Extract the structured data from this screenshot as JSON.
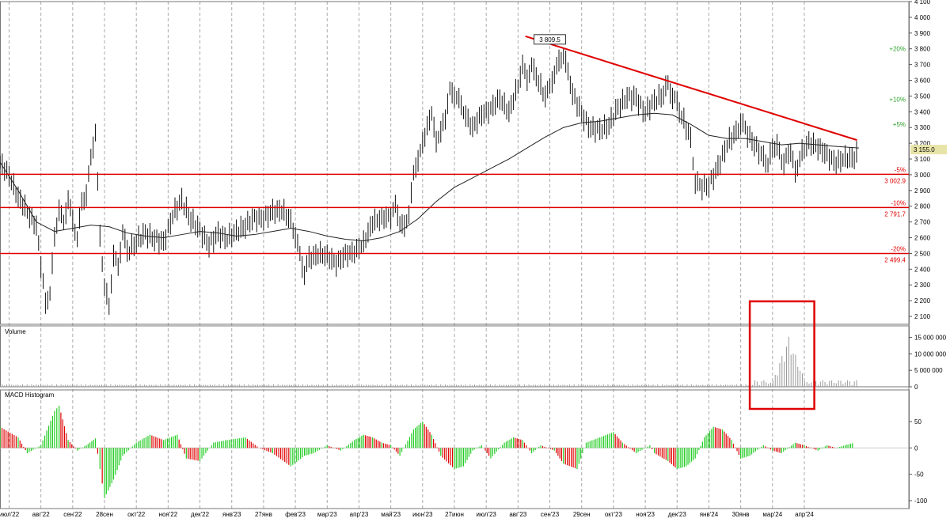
{
  "chart_data": {
    "type": "line",
    "price_panel": {
      "ylim": [
        2050,
        4100
      ],
      "y_ticks": [
        "2 100",
        "2 200",
        "2 300",
        "2 400",
        "2 500",
        "2 600",
        "2 700",
        "2 800",
        "2 900",
        "3 000",
        "3 100",
        "3 200",
        "3 300",
        "3 400",
        "3 500",
        "3 600",
        "3 700",
        "3 800",
        "3 900",
        "4 000",
        "4 100"
      ],
      "last_price_label": "3 155.0",
      "last_price": 3155.0,
      "peak_label": "3 809.5",
      "peak_value": 3809.5,
      "support_levels": [
        {
          "value": 3002.9,
          "label": "3 002.9",
          "pct_label": "-5%"
        },
        {
          "value": 2791.7,
          "label": "2 791.7",
          "pct_label": "-10%"
        },
        {
          "value": 2499.4,
          "label": "2 499.4",
          "pct_label": "-20%"
        }
      ],
      "upper_levels": [
        {
          "value": 3800,
          "pct_label": "+20%"
        },
        {
          "value": 3480,
          "pct_label": "+10%"
        },
        {
          "value": 3320,
          "pct_label": "+5%"
        }
      ],
      "trendline": {
        "start": {
          "x": 0.578,
          "y": 3880
        },
        "end": {
          "x": 0.943,
          "y": 3220
        }
      },
      "price_path": [
        [
          0.0,
          3080
        ],
        [
          0.01,
          2990
        ],
        [
          0.02,
          2860
        ],
        [
          0.03,
          2760
        ],
        [
          0.04,
          2680
        ],
        [
          0.05,
          2180
        ],
        [
          0.055,
          2250
        ],
        [
          0.06,
          2600
        ],
        [
          0.065,
          2780
        ],
        [
          0.07,
          2690
        ],
        [
          0.075,
          2850
        ],
        [
          0.08,
          2700
        ],
        [
          0.085,
          2600
        ],
        [
          0.09,
          2820
        ],
        [
          0.095,
          2880
        ],
        [
          0.1,
          3100
        ],
        [
          0.105,
          3280
        ],
        [
          0.11,
          2600
        ],
        [
          0.115,
          2300
        ],
        [
          0.12,
          2150
        ],
        [
          0.125,
          2500
        ],
        [
          0.13,
          2400
        ],
        [
          0.135,
          2650
        ],
        [
          0.14,
          2500
        ],
        [
          0.15,
          2580
        ],
        [
          0.16,
          2620
        ],
        [
          0.17,
          2600
        ],
        [
          0.18,
          2560
        ],
        [
          0.19,
          2750
        ],
        [
          0.2,
          2830
        ],
        [
          0.21,
          2720
        ],
        [
          0.22,
          2640
        ],
        [
          0.23,
          2560
        ],
        [
          0.24,
          2620
        ],
        [
          0.25,
          2600
        ],
        [
          0.26,
          2630
        ],
        [
          0.27,
          2680
        ],
        [
          0.28,
          2720
        ],
        [
          0.29,
          2730
        ],
        [
          0.3,
          2760
        ],
        [
          0.31,
          2780
        ],
        [
          0.32,
          2700
        ],
        [
          0.325,
          2620
        ],
        [
          0.33,
          2480
        ],
        [
          0.335,
          2380
        ],
        [
          0.34,
          2460
        ],
        [
          0.35,
          2500
        ],
        [
          0.36,
          2480
        ],
        [
          0.37,
          2440
        ],
        [
          0.38,
          2490
        ],
        [
          0.39,
          2510
        ],
        [
          0.4,
          2560
        ],
        [
          0.41,
          2700
        ],
        [
          0.42,
          2720
        ],
        [
          0.43,
          2740
        ],
        [
          0.435,
          2800
        ],
        [
          0.44,
          2700
        ],
        [
          0.445,
          2660
        ],
        [
          0.45,
          2760
        ],
        [
          0.455,
          3000
        ],
        [
          0.46,
          3100
        ],
        [
          0.47,
          3300
        ],
        [
          0.475,
          3400
        ],
        [
          0.48,
          3200
        ],
        [
          0.49,
          3360
        ],
        [
          0.495,
          3540
        ],
        [
          0.5,
          3500
        ],
        [
          0.505,
          3480
        ],
        [
          0.51,
          3400
        ],
        [
          0.52,
          3300
        ],
        [
          0.53,
          3380
        ],
        [
          0.54,
          3420
        ],
        [
          0.55,
          3480
        ],
        [
          0.56,
          3400
        ],
        [
          0.57,
          3560
        ],
        [
          0.575,
          3700
        ],
        [
          0.58,
          3600
        ],
        [
          0.585,
          3700
        ],
        [
          0.59,
          3620
        ],
        [
          0.6,
          3500
        ],
        [
          0.605,
          3560
        ],
        [
          0.61,
          3640
        ],
        [
          0.615,
          3720
        ],
        [
          0.62,
          3760
        ],
        [
          0.625,
          3650
        ],
        [
          0.63,
          3520
        ],
        [
          0.64,
          3380
        ],
        [
          0.65,
          3300
        ],
        [
          0.66,
          3280
        ],
        [
          0.67,
          3320
        ],
        [
          0.68,
          3420
        ],
        [
          0.69,
          3500
        ],
        [
          0.7,
          3480
        ],
        [
          0.71,
          3400
        ],
        [
          0.72,
          3460
        ],
        [
          0.73,
          3520
        ],
        [
          0.735,
          3570
        ],
        [
          0.74,
          3500
        ],
        [
          0.745,
          3450
        ],
        [
          0.75,
          3380
        ],
        [
          0.76,
          3220
        ],
        [
          0.765,
          2960
        ],
        [
          0.77,
          2920
        ],
        [
          0.78,
          2940
        ],
        [
          0.79,
          3040
        ],
        [
          0.8,
          3200
        ],
        [
          0.81,
          3260
        ],
        [
          0.815,
          3340
        ],
        [
          0.82,
          3280
        ],
        [
          0.83,
          3200
        ],
        [
          0.84,
          3100
        ],
        [
          0.845,
          3080
        ],
        [
          0.85,
          3150
        ],
        [
          0.855,
          3210
        ],
        [
          0.86,
          3060
        ],
        [
          0.87,
          3160
        ],
        [
          0.875,
          3000
        ],
        [
          0.88,
          3120
        ],
        [
          0.89,
          3200
        ],
        [
          0.9,
          3180
        ],
        [
          0.91,
          3120
        ],
        [
          0.92,
          3080
        ],
        [
          0.93,
          3100
        ],
        [
          0.94,
          3110
        ],
        [
          0.945,
          3155
        ]
      ],
      "ma_path": [
        [
          0.0,
          3080
        ],
        [
          0.02,
          2900
        ],
        [
          0.04,
          2700
        ],
        [
          0.06,
          2640
        ],
        [
          0.08,
          2660
        ],
        [
          0.1,
          2680
        ],
        [
          0.12,
          2670
        ],
        [
          0.14,
          2630
        ],
        [
          0.16,
          2610
        ],
        [
          0.18,
          2600
        ],
        [
          0.2,
          2620
        ],
        [
          0.22,
          2640
        ],
        [
          0.24,
          2630
        ],
        [
          0.26,
          2610
        ],
        [
          0.28,
          2620
        ],
        [
          0.3,
          2640
        ],
        [
          0.32,
          2660
        ],
        [
          0.34,
          2640
        ],
        [
          0.36,
          2610
        ],
        [
          0.38,
          2590
        ],
        [
          0.4,
          2580
        ],
        [
          0.42,
          2600
        ],
        [
          0.44,
          2640
        ],
        [
          0.46,
          2720
        ],
        [
          0.48,
          2830
        ],
        [
          0.5,
          2920
        ],
        [
          0.52,
          2980
        ],
        [
          0.54,
          3040
        ],
        [
          0.56,
          3100
        ],
        [
          0.58,
          3170
        ],
        [
          0.6,
          3240
        ],
        [
          0.62,
          3300
        ],
        [
          0.64,
          3330
        ],
        [
          0.66,
          3340
        ],
        [
          0.68,
          3360
        ],
        [
          0.7,
          3380
        ],
        [
          0.72,
          3390
        ],
        [
          0.74,
          3380
        ],
        [
          0.76,
          3320
        ],
        [
          0.78,
          3250
        ],
        [
          0.8,
          3230
        ],
        [
          0.82,
          3230
        ],
        [
          0.84,
          3210
        ],
        [
          0.86,
          3190
        ],
        [
          0.88,
          3200
        ],
        [
          0.9,
          3190
        ],
        [
          0.92,
          3180
        ],
        [
          0.945,
          3170
        ]
      ]
    },
    "volume_panel": {
      "title": "Volume",
      "ylim": [
        0,
        18500000
      ],
      "y_ticks": [
        "0",
        "5 000 000",
        "10 000 000",
        "15 000 000"
      ],
      "y_tick_values": [
        0,
        5000000,
        10000000,
        15000000
      ],
      "spike_x": 0.868,
      "spike_value": 15500000
    },
    "macd_panel": {
      "title": "MACD Histogram",
      "ylim": [
        -115,
        110
      ],
      "y_ticks": [
        "-100",
        "-50",
        "0",
        "50"
      ],
      "y_tick_values": [
        -100,
        -50,
        0,
        50
      ],
      "bars": [
        [
          0.0,
          40
        ],
        [
          0.02,
          20
        ],
        [
          0.03,
          -10
        ],
        [
          0.045,
          5
        ],
        [
          0.06,
          70
        ],
        [
          0.065,
          80
        ],
        [
          0.075,
          15
        ],
        [
          0.085,
          -5
        ],
        [
          0.095,
          5
        ],
        [
          0.105,
          18
        ],
        [
          0.11,
          -40
        ],
        [
          0.115,
          -95
        ],
        [
          0.125,
          -60
        ],
        [
          0.135,
          -15
        ],
        [
          0.15,
          10
        ],
        [
          0.165,
          25
        ],
        [
          0.18,
          15
        ],
        [
          0.195,
          25
        ],
        [
          0.205,
          -20
        ],
        [
          0.22,
          -25
        ],
        [
          0.235,
          10
        ],
        [
          0.25,
          15
        ],
        [
          0.27,
          20
        ],
        [
          0.285,
          0
        ],
        [
          0.3,
          -10
        ],
        [
          0.32,
          -35
        ],
        [
          0.335,
          -15
        ],
        [
          0.345,
          -10
        ],
        [
          0.36,
          5
        ],
        [
          0.375,
          -5
        ],
        [
          0.39,
          15
        ],
        [
          0.4,
          25
        ],
        [
          0.41,
          20
        ],
        [
          0.42,
          10
        ],
        [
          0.43,
          5
        ],
        [
          0.44,
          -15
        ],
        [
          0.455,
          35
        ],
        [
          0.465,
          50
        ],
        [
          0.475,
          25
        ],
        [
          0.485,
          -15
        ],
        [
          0.5,
          -40
        ],
        [
          0.51,
          -35
        ],
        [
          0.52,
          -5
        ],
        [
          0.53,
          5
        ],
        [
          0.54,
          -20
        ],
        [
          0.555,
          10
        ],
        [
          0.565,
          20
        ],
        [
          0.575,
          15
        ],
        [
          0.585,
          -10
        ],
        [
          0.595,
          5
        ],
        [
          0.61,
          -5
        ],
        [
          0.62,
          -30
        ],
        [
          0.635,
          -40
        ],
        [
          0.645,
          10
        ],
        [
          0.66,
          20
        ],
        [
          0.675,
          30
        ],
        [
          0.685,
          10
        ],
        [
          0.7,
          -10
        ],
        [
          0.715,
          5
        ],
        [
          0.72,
          -10
        ],
        [
          0.735,
          -25
        ],
        [
          0.745,
          -40
        ],
        [
          0.755,
          -35
        ],
        [
          0.765,
          -20
        ],
        [
          0.775,
          20
        ],
        [
          0.785,
          40
        ],
        [
          0.795,
          35
        ],
        [
          0.805,
          15
        ],
        [
          0.815,
          -20
        ],
        [
          0.825,
          -15
        ],
        [
          0.84,
          5
        ],
        [
          0.85,
          -5
        ],
        [
          0.86,
          -10
        ],
        [
          0.875,
          10
        ],
        [
          0.885,
          5
        ],
        [
          0.9,
          -5
        ],
        [
          0.91,
          5
        ],
        [
          0.92,
          0
        ],
        [
          0.93,
          5
        ],
        [
          0.94,
          10
        ]
      ]
    },
    "x_ticks": [
      "июл'22",
      "авг'22",
      "сен'22",
      "28сен",
      "окт'22",
      "ноя'22",
      "дек'22",
      "янв'23",
      "27янв",
      "фев'23",
      "мар'23",
      "апр'23",
      "май'23",
      "июн'23",
      "27июн",
      "июл'23",
      "авг'23",
      "сен'23",
      "29сен",
      "окт'23",
      "ноя'23",
      "дек'23",
      "янв'24",
      "30янв",
      "мар'24",
      "апр'24"
    ],
    "x_tick_positions": [
      0.01,
      0.045,
      0.08,
      0.115,
      0.15,
      0.185,
      0.22,
      0.255,
      0.29,
      0.325,
      0.36,
      0.395,
      0.43,
      0.465,
      0.5,
      0.535,
      0.57,
      0.605,
      0.64,
      0.675,
      0.71,
      0.745,
      0.78,
      0.815,
      0.85,
      0.885
    ],
    "annotation_box": {
      "x0": 0.825,
      "x1": 0.896
    },
    "grid": true
  }
}
